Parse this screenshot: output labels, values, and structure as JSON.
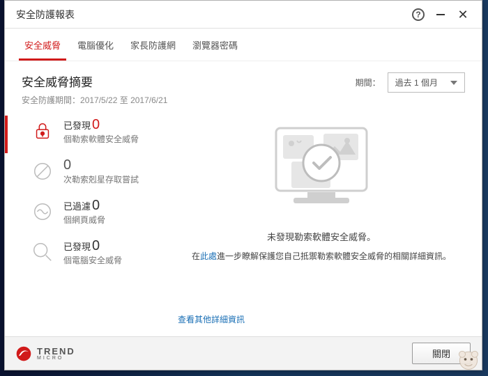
{
  "window": {
    "title": "安全防護報表"
  },
  "tabs": [
    "安全威脅",
    "電腦優化",
    "家長防護網",
    "瀏覽器密碼"
  ],
  "active_tab": 0,
  "summary": {
    "title": "安全威脅摘要",
    "period_label": "安全防護期間：",
    "period_range": "2017/5/22 至 2017/6/21"
  },
  "period_picker": {
    "label": "期間：",
    "selected": "過去 1 個月"
  },
  "stats": [
    {
      "prefix": "已發現",
      "count": "0",
      "desc": "個勒索軟體安全威脅",
      "icon": "lock-alert-icon",
      "active": true,
      "color": "#d11a1a"
    },
    {
      "prefix": "",
      "count": "0",
      "desc": "次勒索剋星存取嘗試",
      "icon": "slash-circle-icon",
      "active": false,
      "color": "#999"
    },
    {
      "prefix": "已過濾",
      "count": "0",
      "desc": "個網頁威脅",
      "icon": "wave-circle-icon",
      "active": false,
      "color": "#999"
    },
    {
      "prefix": "已發現",
      "count": "0",
      "desc": "個電腦安全威脅",
      "icon": "search-icon",
      "active": false,
      "color": "#999"
    }
  ],
  "detail": {
    "main": "未發現勒索軟體安全威脅。",
    "sub_prefix": "在",
    "sub_link": "此處",
    "sub_suffix": "進一步瞭解保護您自己抵禦勒索軟體安全威脅的相關詳細資訊。",
    "more_link": "查看其他詳細資訊"
  },
  "footer": {
    "brand_top": "TREND",
    "brand_bottom": "MICRO",
    "close": "關閉"
  }
}
